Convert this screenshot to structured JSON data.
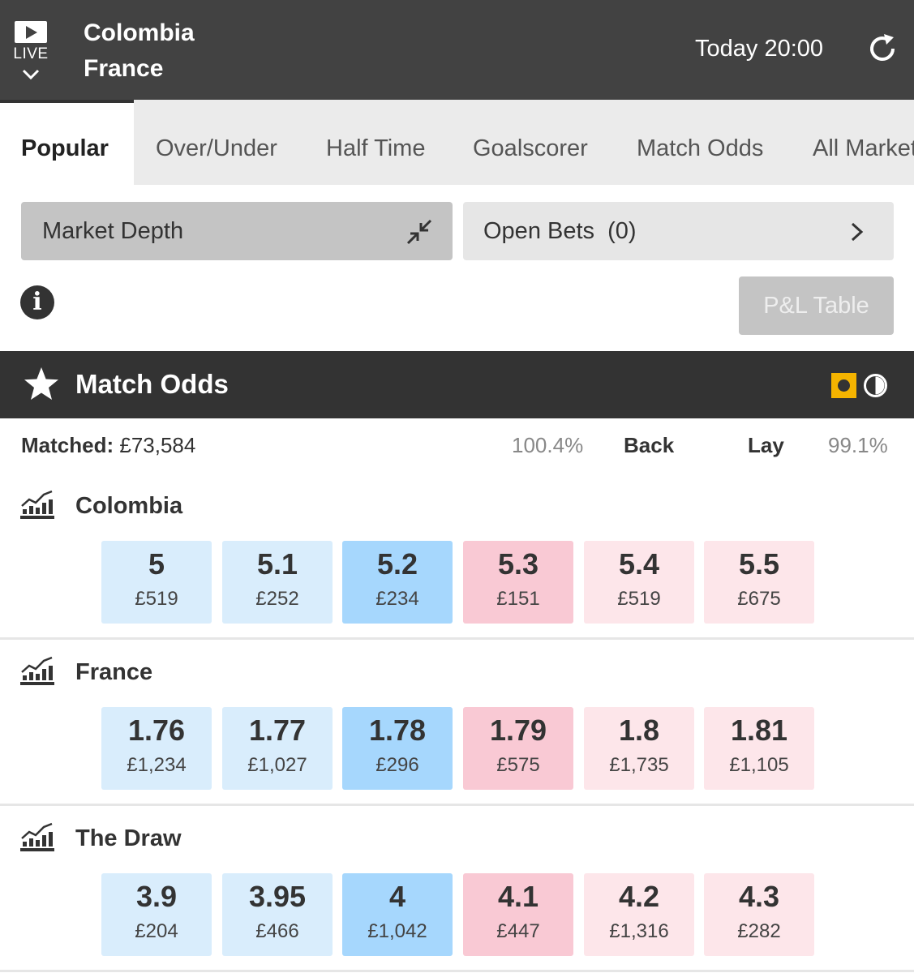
{
  "header": {
    "live_label": "LIVE",
    "team_home": "Colombia",
    "team_away": "France",
    "time": "Today 20:00"
  },
  "tabs": [
    {
      "label": "Popular",
      "active": true
    },
    {
      "label": "Over/Under"
    },
    {
      "label": "Half Time"
    },
    {
      "label": "Goalscorer"
    },
    {
      "label": "Match Odds"
    },
    {
      "label": "All Markets"
    }
  ],
  "buttons": {
    "market_depth": "Market Depth",
    "open_bets": "Open Bets  (0)",
    "pl_table": "P&L Table"
  },
  "market": {
    "title": "Match Odds",
    "matched_label": "Matched:",
    "matched_value": "£73,584",
    "back_pct": "100.4%",
    "back_label": "Back",
    "lay_label": "Lay",
    "lay_pct": "99.1%"
  },
  "runners": [
    {
      "name": "Colombia",
      "prices": [
        {
          "price": "5",
          "size": "£519"
        },
        {
          "price": "5.1",
          "size": "£252"
        },
        {
          "price": "5.2",
          "size": "£234"
        },
        {
          "price": "5.3",
          "size": "£151"
        },
        {
          "price": "5.4",
          "size": "£519"
        },
        {
          "price": "5.5",
          "size": "£675"
        }
      ]
    },
    {
      "name": "France",
      "prices": [
        {
          "price": "1.76",
          "size": "£1,234"
        },
        {
          "price": "1.77",
          "size": "£1,027"
        },
        {
          "price": "1.78",
          "size": "£296"
        },
        {
          "price": "1.79",
          "size": "£575"
        },
        {
          "price": "1.8",
          "size": "£1,735"
        },
        {
          "price": "1.81",
          "size": "£1,105"
        }
      ]
    },
    {
      "name": "The Draw",
      "prices": [
        {
          "price": "3.9",
          "size": "£204"
        },
        {
          "price": "3.95",
          "size": "£466"
        },
        {
          "price": "4",
          "size": "£1,042"
        },
        {
          "price": "4.1",
          "size": "£447"
        },
        {
          "price": "4.2",
          "size": "£1,316"
        },
        {
          "price": "4.3",
          "size": "£282"
        }
      ]
    }
  ],
  "colors": {
    "header_bg": "#424242",
    "back_light": "#d9edfc",
    "back_best": "#a6d7fd",
    "lay_best": "#f9c9d4",
    "lay_light": "#fde6ea",
    "live_indicator": "#f5b400"
  },
  "icons": [
    "live-play-icon",
    "chevron-down-icon",
    "refresh-icon",
    "collapse-icon",
    "chevron-right-icon",
    "info-icon",
    "star-icon",
    "in-play-icon",
    "timer-icon",
    "market-chart-icon"
  ]
}
